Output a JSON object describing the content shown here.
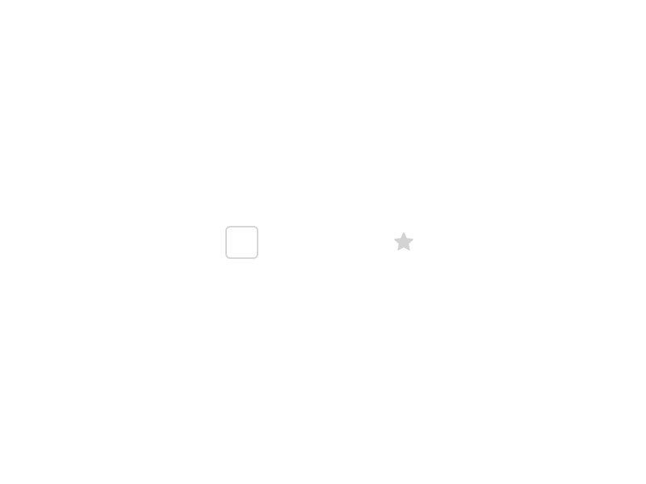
{
  "checkbox": {
    "checked": false,
    "border_color": "#d6d6d6"
  },
  "favorite": {
    "icon": "star-icon",
    "active": false,
    "color": "#d3d3d3"
  }
}
